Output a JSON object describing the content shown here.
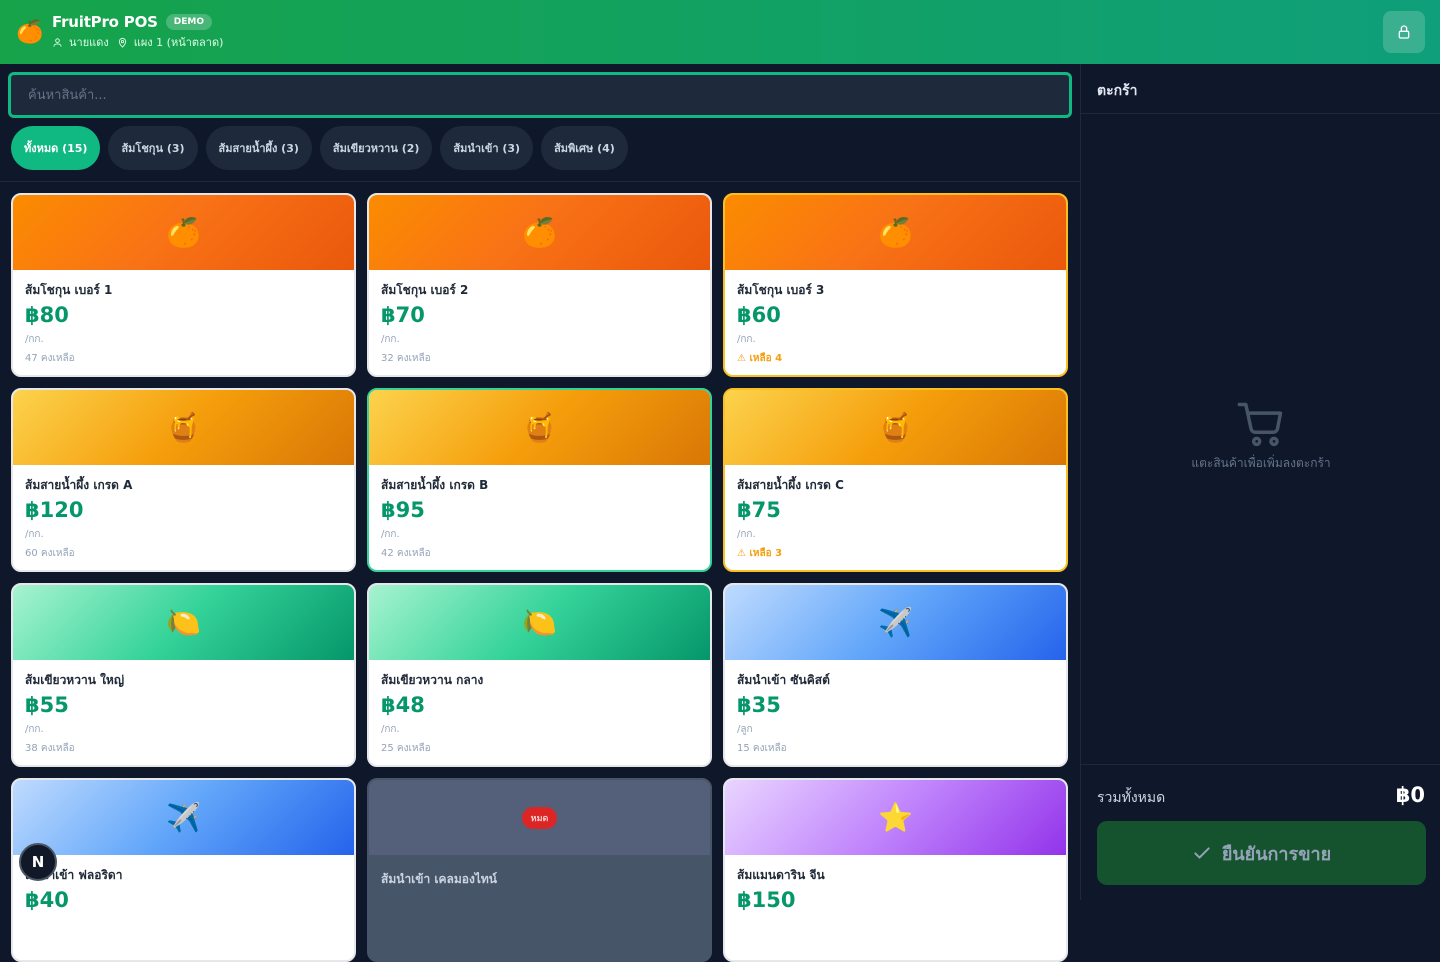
{
  "header": {
    "logo_glyph": "🍊",
    "brand": "FruitPro POS",
    "badge": "DEMO",
    "user": "นายแดง",
    "location": "แผง 1 (หน้าตลาด)"
  },
  "search": {
    "placeholder": "ค้นหาสินค้า..."
  },
  "tabs": [
    {
      "label": "ทั้งหมด (15)",
      "active": true
    },
    {
      "label": "ส้มโชกุน (3)"
    },
    {
      "label": "ส้มสายน้ำผึ้ง (3)"
    },
    {
      "label": "ส้มเขียวหวาน (2)"
    },
    {
      "label": "ส้มนำเข้า (3)"
    },
    {
      "label": "ส้มพิเศษ (4)"
    }
  ],
  "products": [
    {
      "icon": "🍊",
      "name": "ส้มโชกุน เบอร์ 1",
      "price": "฿80",
      "unit": "/กก.",
      "stock": "47 คงเหลือ"
    },
    {
      "icon": "🍊",
      "name": "ส้มโชกุน เบอร์ 2",
      "price": "฿70",
      "unit": "/กก.",
      "stock": "32 คงเหลือ"
    },
    {
      "icon": "🍊",
      "name": "ส้มโชกุน เบอร์ 3",
      "price": "฿60",
      "unit": "/กก.",
      "stock": "⚠ เหลือ 4"
    },
    {
      "icon": "🍯",
      "name": "ส้มสายน้ำผึ้ง เกรด A",
      "price": "฿120",
      "unit": "/กก.",
      "stock": "60 คงเหลือ"
    },
    {
      "icon": "🍯",
      "name": "ส้มสายน้ำผึ้ง เกรด B",
      "price": "฿95",
      "unit": "/กก.",
      "stock": "42 คงเหลือ"
    },
    {
      "icon": "🍯",
      "name": "ส้มสายน้ำผึ้ง เกรด C",
      "price": "฿75",
      "unit": "/กก.",
      "stock": "⚠ เหลือ 3"
    },
    {
      "icon": "🍋",
      "name": "ส้มเขียวหวาน ใหญ่",
      "price": "฿55",
      "unit": "/กก.",
      "stock": "38 คงเหลือ"
    },
    {
      "icon": "🍋",
      "name": "ส้มเขียวหวาน กลาง",
      "price": "฿48",
      "unit": "/กก.",
      "stock": "25 คงเหลือ"
    },
    {
      "icon": "✈️",
      "name": "ส้มนำเข้า ซันคิสต์",
      "price": "฿35",
      "unit": "/ลูก",
      "stock": "15 คงเหลือ"
    },
    {
      "icon": "✈️",
      "name": "ส้มนำเข้า ฟลอริดา",
      "price": "฿40"
    },
    {
      "badge": "หมด",
      "name": "ส้มนำเข้า เคลมองไทน์"
    },
    {
      "icon": "⭐",
      "name": "ส้มแมนดาริน จีน",
      "price": "฿150"
    }
  ],
  "fab": {
    "label": "N"
  },
  "cart": {
    "title": "ตะกร้า",
    "empty_text": "แตะสินค้าเพื่อเพิ่มลงตะกร้า",
    "total_label": "รวมทั้งหมด",
    "total_value": "฿0",
    "confirm_label": "ยืนยันการขาย"
  }
}
